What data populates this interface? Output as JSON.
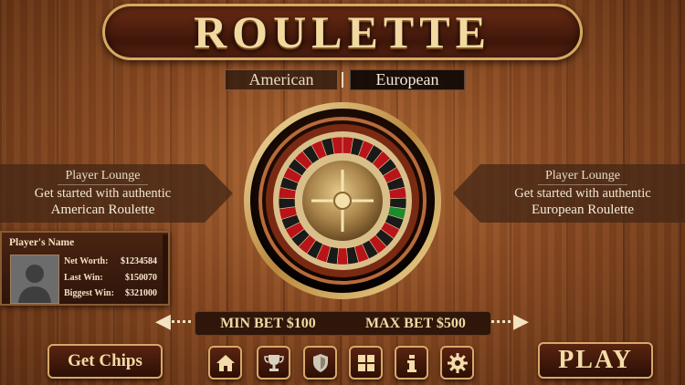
{
  "title": "ROULETTE",
  "variants": {
    "american": "American",
    "european": "European",
    "selected": "European"
  },
  "lounge_left": {
    "title": "Player Lounge",
    "line1": "Get started with authentic",
    "line2": "American Roulette"
  },
  "lounge_right": {
    "title": "Player Lounge",
    "line1": "Get started with authentic",
    "line2": "European Roulette"
  },
  "player": {
    "name_label": "Player's Name",
    "net_worth_label": "Net Worth:",
    "net_worth": "$1234584",
    "last_win_label": "Last Win:",
    "last_win": "$150070",
    "biggest_win_label": "Biggest Win:",
    "biggest_win": "$321000"
  },
  "bets": {
    "min": "MIN BET $100",
    "max": "MAX BET $500"
  },
  "buttons": {
    "get_chips": "Get Chips",
    "play": "PLAY"
  },
  "toolbar_icons": [
    "home-icon",
    "trophy-icon",
    "shield-icon",
    "grid-icon",
    "info-icon",
    "gear-icon"
  ],
  "colors": {
    "wood": "#8a4a22",
    "gold": "#d9a868",
    "felt_red": "#b8141a",
    "pocket_black": "#1a1a1a",
    "pocket_green": "#1d8a2e"
  }
}
